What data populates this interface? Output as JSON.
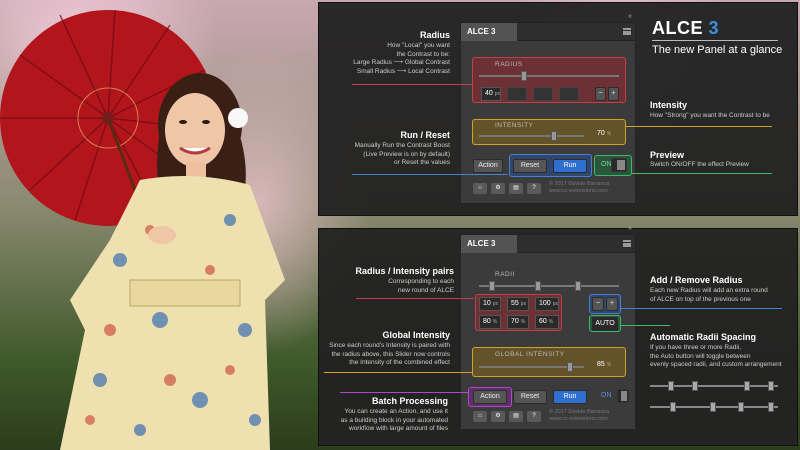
{
  "brand": {
    "name": "ALCE",
    "version": "3",
    "subtitle": "The new Panel at a glance"
  },
  "panel1": {
    "tab": "ALCE 3",
    "radius_label": "RADIUS",
    "radius_value": "40",
    "radius_unit": "px",
    "intensity_label": "INTENSITY",
    "intensity_value": "70",
    "intensity_unit": "%",
    "action": "Action",
    "reset": "Reset",
    "run": "Run",
    "on": "ON",
    "minus": "−",
    "plus": "+",
    "copyright": "© 2017 Davide Barranca",
    "site": "www.cc-extensions.com"
  },
  "panel2": {
    "tab": "ALCE 3",
    "radii_label": "RADII",
    "radii": [
      "10",
      "55",
      "100"
    ],
    "radius_unit": "px",
    "intensities": [
      "80",
      "70",
      "60"
    ],
    "intensity_unit": "%",
    "auto": "AUTO",
    "minus": "−",
    "plus": "+",
    "global_label": "GLOBAL INTENSITY",
    "global_value": "85",
    "global_unit": "%",
    "action": "Action",
    "reset": "Reset",
    "run": "Run",
    "on": "ON",
    "copyright": "© 2017 Davide Barranca",
    "site": "www.cc-extensions.com"
  },
  "annotations": {
    "radius_title": "Radius",
    "radius_desc": [
      "How \"Local\" you want",
      "the Contrast to be:",
      "Large Radius ⟶ Global Contrast",
      "Small Radius ⟶ Local Contrast"
    ],
    "runreset_title": "Run / Reset",
    "runreset_desc": [
      "Manually Run the Contrast Boost",
      "(Live Preview is on by default)",
      "or Reset the values"
    ],
    "intensity_title": "Intensity",
    "intensity_desc": [
      "How \"Strong\" you want the Contrast to be"
    ],
    "preview_title": "Preview",
    "preview_desc": [
      "Switch ON/OFF the effect Preview"
    ],
    "pairs_title": "Radius / Intensity pairs",
    "pairs_desc": [
      "Corresponding to each",
      "new round of ALCE"
    ],
    "global_title": "Global Intensity",
    "global_desc": [
      "Since each round's Intensity is paired with",
      "the radius above, this Slider now controls",
      "the Intensity of the combined effect"
    ],
    "batch_title": "Batch Processing",
    "batch_desc": [
      "You can create an Action, and use it",
      "as a building block in your automated",
      "workflow with large amount of files"
    ],
    "addremove_title": "Add / Remove Radius",
    "addremove_desc": [
      "Each new Radius will add an extra round",
      "of ALCE on top of the previous one"
    ],
    "auto_title": "Automatic Radii Spacing",
    "auto_desc": [
      "If you have three or more Radii,",
      "the Auto button will toggle between",
      "evenly spaced radii, and custom arrangement"
    ]
  },
  "icons": [
    "home-icon",
    "gear-icon",
    "document-icon",
    "help-icon",
    "menu-icon"
  ],
  "colors": {
    "red": "#c0404a",
    "yellow": "#d1a22a",
    "blue": "#4a7fd0",
    "green": "#3fb86a",
    "purple": "#b048c8",
    "accent": "#3c8ee0"
  }
}
